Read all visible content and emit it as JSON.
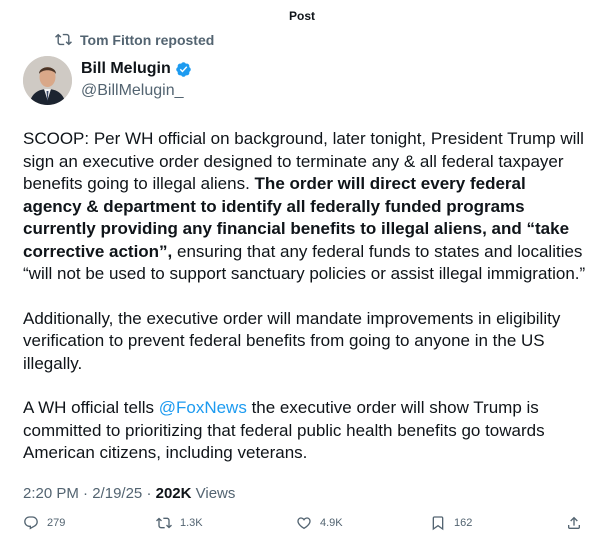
{
  "header": {
    "title": "Post"
  },
  "repost": {
    "text": "Tom Fitton reposted",
    "icon": "repost-icon"
  },
  "author": {
    "name": "Bill Melugin",
    "handle": "@BillMelugin_",
    "verified_color": "#1d9bf0"
  },
  "tweet": {
    "p1_normal": "SCOOP: Per WH official on background, later tonight, President Trump will sign an executive order designed to terminate any & all federal taxpayer benefits going to illegal aliens. ",
    "p1_bold": "The order will direct every federal agency & department to identify all federally funded programs currently providing any financial benefits to illegal aliens, and “take corrective action”,",
    "p1_tail": " ensuring that any federal funds to states and localities “will not be used to support sanctuary policies or assist illegal immigration.”",
    "p2": "Additionally, the executive order will mandate improvements in eligibility verification to prevent federal benefits from going to anyone in the US illegally.",
    "p3_before": "A WH official tells ",
    "p3_mention": "@FoxNews",
    "p3_after": " the executive order will show Trump is committed to prioritizing that federal public health benefits go towards American citizens, including veterans."
  },
  "meta": {
    "time": "2:20 PM",
    "date": "2/19/25",
    "views_count": "202K",
    "views_label": "Views"
  },
  "actions": {
    "replies": "279",
    "reposts": "1.3K",
    "likes": "4.9K",
    "bookmarks": "162"
  },
  "colors": {
    "link": "#1d9bf0",
    "muted": "#536471",
    "text": "#0f1419"
  }
}
